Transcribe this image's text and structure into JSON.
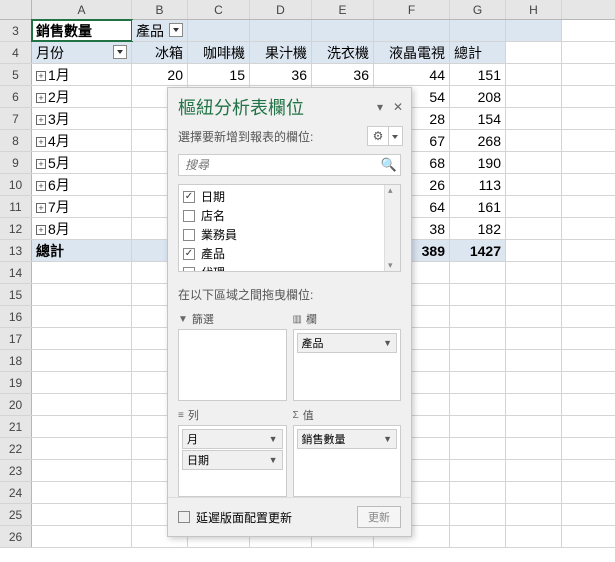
{
  "columns": [
    "A",
    "B",
    "C",
    "D",
    "E",
    "F",
    "G",
    "H"
  ],
  "row3": {
    "a": "銷售數量",
    "b": "產品"
  },
  "row4": {
    "a": "月份",
    "b": "冰箱",
    "c": "咖啡機",
    "d": "果汁機",
    "e": "洗衣機",
    "f": "液晶電視",
    "g": "總計"
  },
  "rows": [
    {
      "n": 5,
      "m": "1月",
      "b": "20",
      "c": "15",
      "d": "36",
      "e": "36",
      "f": "44",
      "g": "151"
    },
    {
      "n": 6,
      "m": "2月",
      "f": "54",
      "g": "208"
    },
    {
      "n": 7,
      "m": "3月",
      "f": "28",
      "g": "154"
    },
    {
      "n": 8,
      "m": "4月",
      "f": "67",
      "g": "268"
    },
    {
      "n": 9,
      "m": "5月",
      "f": "68",
      "g": "190"
    },
    {
      "n": 10,
      "m": "6月",
      "f": "26",
      "g": "113"
    },
    {
      "n": 11,
      "m": "7月",
      "f": "64",
      "g": "161"
    },
    {
      "n": 12,
      "m": "8月",
      "f": "38",
      "g": "182"
    }
  ],
  "total": {
    "n": 13,
    "label": "總計",
    "f": "389",
    "g": "1427"
  },
  "empty_rows": [
    14,
    15,
    16,
    17,
    18,
    19,
    20,
    21,
    22,
    23,
    24,
    25,
    26
  ],
  "pivot": {
    "title": "樞紐分析表欄位",
    "subtitle": "選擇要新增到報表的欄位:",
    "search_placeholder": "搜尋",
    "fields": [
      {
        "label": "日期",
        "checked": true
      },
      {
        "label": "店名",
        "checked": false
      },
      {
        "label": "業務員",
        "checked": false
      },
      {
        "label": "產品",
        "checked": true
      },
      {
        "label": "代理",
        "checked": false
      }
    ],
    "areas_label": "在以下區域之間拖曳欄位:",
    "filters": {
      "title": "篩選"
    },
    "cols": {
      "title": "欄",
      "items": [
        "產品"
      ]
    },
    "rows_area": {
      "title": "列",
      "items": [
        "月",
        "日期"
      ]
    },
    "values": {
      "title": "值",
      "items": [
        "銷售數量"
      ]
    },
    "defer_label": "延遲版面配置更新",
    "update_btn": "更新"
  }
}
